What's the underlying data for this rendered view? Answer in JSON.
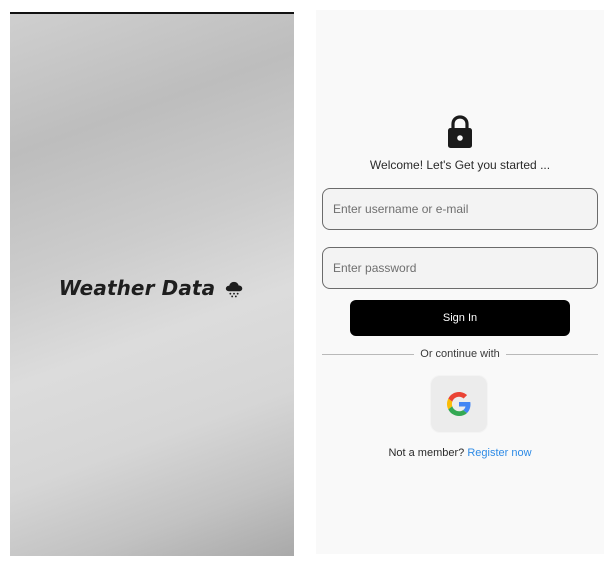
{
  "splash": {
    "title": "Weather Data",
    "icon": "rain-cloud-icon"
  },
  "login": {
    "icon": "lock-icon",
    "welcome": "Welcome! Let's Get you started ...",
    "username_placeholder": "Enter username or e-mail",
    "password_placeholder": "Enter password",
    "signin_label": "Sign In",
    "divider_text": "Or continue with",
    "google_icon": "google-icon",
    "not_member_text": "Not a member?",
    "register_label": "Register now"
  },
  "colors": {
    "primary_button": "#000000",
    "link": "#2e8be6",
    "login_background": "#f9f9f9"
  }
}
